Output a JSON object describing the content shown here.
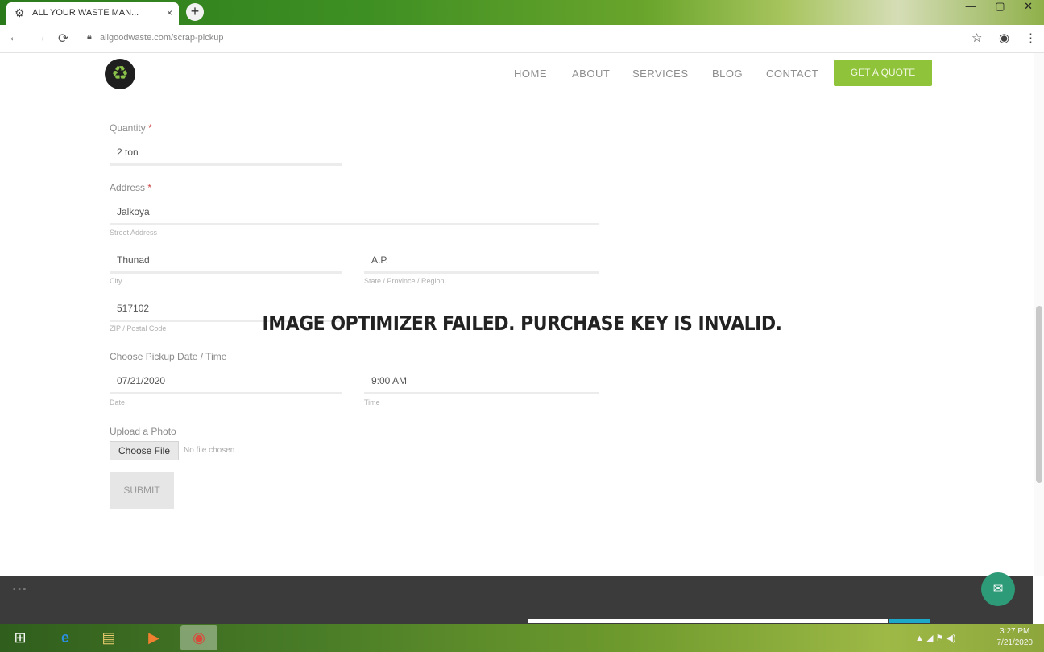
{
  "browser": {
    "tab_title": "ALL YOUR WASTE MAN...",
    "tab_favicon": "gear-icon",
    "tab_close": "×",
    "new_tab": "+",
    "window_controls": "— ▢ ✕",
    "url": "allgoodwaste.com/scrap-pickup",
    "nav": {
      "back": "←",
      "forward": "→",
      "reload": "⟳"
    },
    "right_icons": {
      "star": "☆",
      "profile": "◉",
      "menu": "⋮"
    }
  },
  "site": {
    "logo_glyph": "♻",
    "nav": [
      {
        "label": "HOME"
      },
      {
        "label": "ABOUT"
      },
      {
        "label": "SERVICES"
      },
      {
        "label": "BLOG"
      },
      {
        "label": "CONTACT"
      }
    ],
    "cta_label": "GET A QUOTE",
    "cut_off_text": "..."
  },
  "form": {
    "quantity": {
      "label": "Quantity",
      "required": "*",
      "value": "2 ton"
    },
    "address": {
      "label": "Address",
      "required": "*",
      "street": {
        "value": "Jalkoya",
        "sub": "Street Address"
      },
      "city": {
        "value": "Thunad",
        "sub": "City"
      },
      "state": {
        "value": "A.P.",
        "sub": "State / Province / Region"
      },
      "zip": {
        "value": "517102",
        "sub": "ZIP / Postal Code"
      }
    },
    "pickup": {
      "label": "Choose Pickup Date / Time",
      "date": {
        "value": "07/21/2020",
        "sub": "Date"
      },
      "time": {
        "value": "9:00 AM",
        "sub": "Time"
      }
    },
    "upload": {
      "label": "Upload a Photo",
      "button": "Choose File",
      "none": "No file chosen"
    },
    "submit_label": "SUBMIT"
  },
  "overlay_message": "IMAGE OPTIMIZER FAILED. PURCHASE KEY IS INVALID.",
  "chat_icon": "✉",
  "footer_dots": "▪ ▪ ▪",
  "taskbar": {
    "start": "⊞",
    "ie": "e",
    "explorer": "▤",
    "media": "▶",
    "chrome": "◉",
    "tray_text": "▲ ◢ ⚑ ◀)",
    "time": "3:27 PM",
    "date": "7/21/2020"
  }
}
